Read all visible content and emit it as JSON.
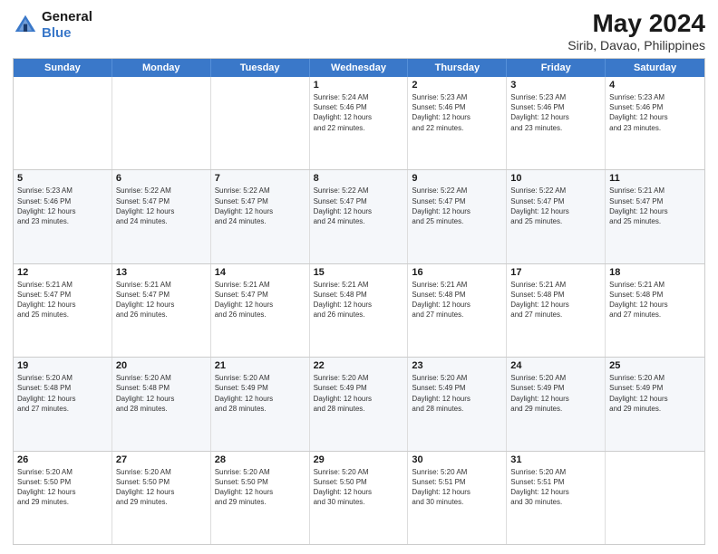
{
  "header": {
    "logo_line1": "General",
    "logo_line2": "Blue",
    "title": "May 2024",
    "subtitle": "Sirib, Davao, Philippines"
  },
  "days_of_week": [
    "Sunday",
    "Monday",
    "Tuesday",
    "Wednesday",
    "Thursday",
    "Friday",
    "Saturday"
  ],
  "weeks": [
    {
      "alt": false,
      "days": [
        {
          "date": "",
          "info": ""
        },
        {
          "date": "",
          "info": ""
        },
        {
          "date": "",
          "info": ""
        },
        {
          "date": "1",
          "info": "Sunrise: 5:24 AM\nSunset: 5:46 PM\nDaylight: 12 hours\nand 22 minutes."
        },
        {
          "date": "2",
          "info": "Sunrise: 5:23 AM\nSunset: 5:46 PM\nDaylight: 12 hours\nand 22 minutes."
        },
        {
          "date": "3",
          "info": "Sunrise: 5:23 AM\nSunset: 5:46 PM\nDaylight: 12 hours\nand 23 minutes."
        },
        {
          "date": "4",
          "info": "Sunrise: 5:23 AM\nSunset: 5:46 PM\nDaylight: 12 hours\nand 23 minutes."
        }
      ]
    },
    {
      "alt": true,
      "days": [
        {
          "date": "5",
          "info": "Sunrise: 5:23 AM\nSunset: 5:46 PM\nDaylight: 12 hours\nand 23 minutes."
        },
        {
          "date": "6",
          "info": "Sunrise: 5:22 AM\nSunset: 5:47 PM\nDaylight: 12 hours\nand 24 minutes."
        },
        {
          "date": "7",
          "info": "Sunrise: 5:22 AM\nSunset: 5:47 PM\nDaylight: 12 hours\nand 24 minutes."
        },
        {
          "date": "8",
          "info": "Sunrise: 5:22 AM\nSunset: 5:47 PM\nDaylight: 12 hours\nand 24 minutes."
        },
        {
          "date": "9",
          "info": "Sunrise: 5:22 AM\nSunset: 5:47 PM\nDaylight: 12 hours\nand 25 minutes."
        },
        {
          "date": "10",
          "info": "Sunrise: 5:22 AM\nSunset: 5:47 PM\nDaylight: 12 hours\nand 25 minutes."
        },
        {
          "date": "11",
          "info": "Sunrise: 5:21 AM\nSunset: 5:47 PM\nDaylight: 12 hours\nand 25 minutes."
        }
      ]
    },
    {
      "alt": false,
      "days": [
        {
          "date": "12",
          "info": "Sunrise: 5:21 AM\nSunset: 5:47 PM\nDaylight: 12 hours\nand 25 minutes."
        },
        {
          "date": "13",
          "info": "Sunrise: 5:21 AM\nSunset: 5:47 PM\nDaylight: 12 hours\nand 26 minutes."
        },
        {
          "date": "14",
          "info": "Sunrise: 5:21 AM\nSunset: 5:47 PM\nDaylight: 12 hours\nand 26 minutes."
        },
        {
          "date": "15",
          "info": "Sunrise: 5:21 AM\nSunset: 5:48 PM\nDaylight: 12 hours\nand 26 minutes."
        },
        {
          "date": "16",
          "info": "Sunrise: 5:21 AM\nSunset: 5:48 PM\nDaylight: 12 hours\nand 27 minutes."
        },
        {
          "date": "17",
          "info": "Sunrise: 5:21 AM\nSunset: 5:48 PM\nDaylight: 12 hours\nand 27 minutes."
        },
        {
          "date": "18",
          "info": "Sunrise: 5:21 AM\nSunset: 5:48 PM\nDaylight: 12 hours\nand 27 minutes."
        }
      ]
    },
    {
      "alt": true,
      "days": [
        {
          "date": "19",
          "info": "Sunrise: 5:20 AM\nSunset: 5:48 PM\nDaylight: 12 hours\nand 27 minutes."
        },
        {
          "date": "20",
          "info": "Sunrise: 5:20 AM\nSunset: 5:48 PM\nDaylight: 12 hours\nand 28 minutes."
        },
        {
          "date": "21",
          "info": "Sunrise: 5:20 AM\nSunset: 5:49 PM\nDaylight: 12 hours\nand 28 minutes."
        },
        {
          "date": "22",
          "info": "Sunrise: 5:20 AM\nSunset: 5:49 PM\nDaylight: 12 hours\nand 28 minutes."
        },
        {
          "date": "23",
          "info": "Sunrise: 5:20 AM\nSunset: 5:49 PM\nDaylight: 12 hours\nand 28 minutes."
        },
        {
          "date": "24",
          "info": "Sunrise: 5:20 AM\nSunset: 5:49 PM\nDaylight: 12 hours\nand 29 minutes."
        },
        {
          "date": "25",
          "info": "Sunrise: 5:20 AM\nSunset: 5:49 PM\nDaylight: 12 hours\nand 29 minutes."
        }
      ]
    },
    {
      "alt": false,
      "days": [
        {
          "date": "26",
          "info": "Sunrise: 5:20 AM\nSunset: 5:50 PM\nDaylight: 12 hours\nand 29 minutes."
        },
        {
          "date": "27",
          "info": "Sunrise: 5:20 AM\nSunset: 5:50 PM\nDaylight: 12 hours\nand 29 minutes."
        },
        {
          "date": "28",
          "info": "Sunrise: 5:20 AM\nSunset: 5:50 PM\nDaylight: 12 hours\nand 29 minutes."
        },
        {
          "date": "29",
          "info": "Sunrise: 5:20 AM\nSunset: 5:50 PM\nDaylight: 12 hours\nand 30 minutes."
        },
        {
          "date": "30",
          "info": "Sunrise: 5:20 AM\nSunset: 5:51 PM\nDaylight: 12 hours\nand 30 minutes."
        },
        {
          "date": "31",
          "info": "Sunrise: 5:20 AM\nSunset: 5:51 PM\nDaylight: 12 hours\nand 30 minutes."
        },
        {
          "date": "",
          "info": ""
        }
      ]
    }
  ]
}
